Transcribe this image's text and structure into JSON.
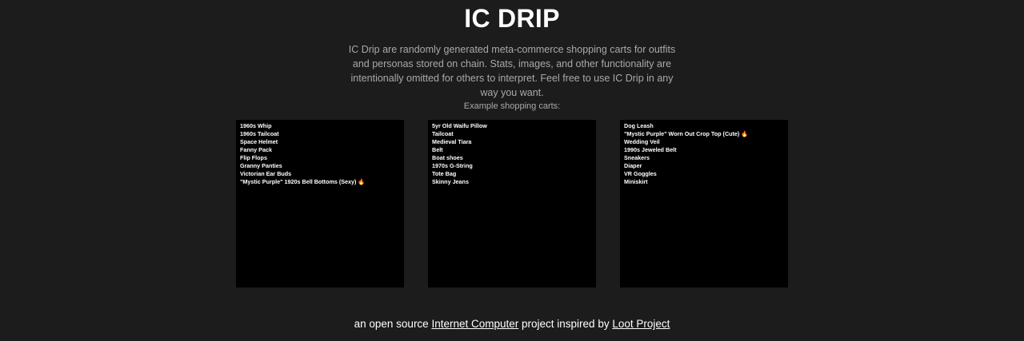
{
  "header": {
    "title": "IC DRIP",
    "description": "IC Drip are randomly generated meta-commerce shopping carts for outfits and personas stored on chain. Stats, images, and other functionality are intentionally omitted for others to interpret. Feel free to use IC Drip in any way you want."
  },
  "carts_section": {
    "heading": "Example shopping carts:",
    "carts": [
      {
        "items": [
          "1960s Whip",
          "1960s Tailcoat",
          "Space Helmet",
          "Fanny Pack",
          "Flip Flops",
          "Granny Panties",
          "Victorian Ear Buds",
          "\"Mystic Purple\" 1920s Bell Bottoms (Sexy) 🔥"
        ]
      },
      {
        "items": [
          "5yr Old Waifu Pillow",
          "Tailcoat",
          "Medieval Tiara",
          "Belt",
          "Boat shoes",
          "1970s G-String",
          "Tote Bag",
          "Skinny Jeans"
        ]
      },
      {
        "items": [
          "Dog Leash",
          "\"Mystic Purple\" Worn Out Crop Top (Cute) 🔥",
          "Wedding Veil",
          "1990s Jeweled Belt",
          "Sneakers",
          "Diaper",
          "VR Goggles",
          "Miniskirt"
        ]
      }
    ]
  },
  "footer": {
    "prefix": "an open source ",
    "link1": "Internet Computer",
    "middle": " project inspired by ",
    "link2": "Loot Project"
  }
}
